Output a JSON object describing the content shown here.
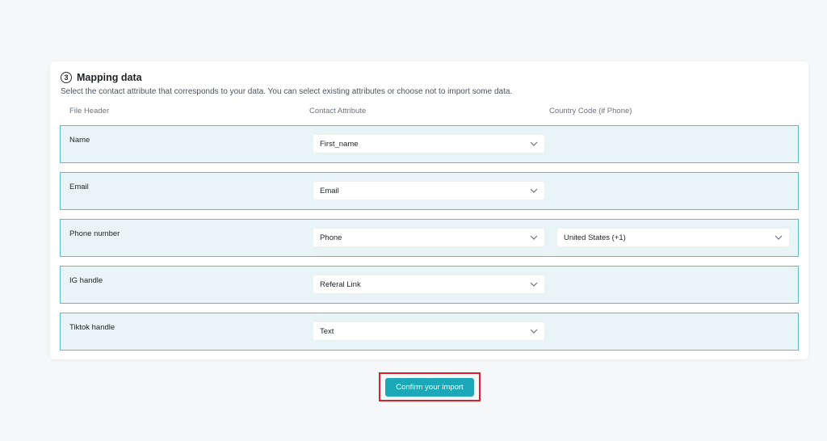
{
  "section": {
    "step_number": "3",
    "title": "Mapping data",
    "description": "Select the contact attribute that corresponds to your data. You can select existing attributes or choose not to import some data."
  },
  "columns": {
    "file_header": "File Header",
    "contact_attribute": "Contact Attribute",
    "country_code": "Country Code (if Phone)"
  },
  "rows": [
    {
      "label": "Name",
      "attribute": "First_name"
    },
    {
      "label": "Email",
      "attribute": "Email"
    },
    {
      "label": "Phone number",
      "attribute": "Phone",
      "country": "United States (+1)"
    },
    {
      "label": "IG handle",
      "attribute": "Referal Link"
    },
    {
      "label": "Tiktok handle",
      "attribute": "Text"
    }
  ],
  "confirm_label": "Confirm your import",
  "colors": {
    "accent": "#1ba8b8",
    "row_border": "#56bfcc",
    "row_bg": "#e9f4f6",
    "highlight": "#d9232a"
  },
  "icons": {
    "step": "step-number-circle-icon",
    "dropdown": "chevron-down-icon"
  }
}
